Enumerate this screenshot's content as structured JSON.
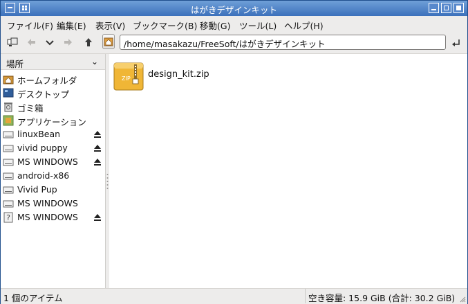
{
  "window": {
    "title": "はがきデザインキット"
  },
  "menu": {
    "file": "ファイル(F)",
    "edit": "編集(E)",
    "view": "表示(V)",
    "bookmarks": "ブックマーク(B)",
    "go": "移動(G)",
    "tools": "ツール(L)",
    "help": "ヘルプ(H)"
  },
  "toolbar": {
    "location": "/home/masakazu/FreeSoft/はがきデザインキット"
  },
  "sidebar": {
    "header": "場所",
    "items": [
      {
        "label": "ホームフォルダ",
        "icon": "home-folder-icon"
      },
      {
        "label": "デスクトップ",
        "icon": "desktop-icon"
      },
      {
        "label": "ゴミ箱",
        "icon": "trash-icon"
      },
      {
        "label": "アプリケーション",
        "icon": "applications-icon"
      },
      {
        "label": "linuxBean",
        "icon": "drive-icon",
        "eject": true
      },
      {
        "label": "vivid puppy",
        "icon": "drive-icon",
        "eject": true
      },
      {
        "label": "MS WINDOWS",
        "icon": "drive-icon",
        "eject": true
      },
      {
        "label": "android-x86",
        "icon": "drive-icon",
        "eject": false
      },
      {
        "label": "Vivid Pup",
        "icon": "drive-icon",
        "eject": false
      },
      {
        "label": "MS WINDOWS",
        "icon": "drive-icon",
        "eject": false
      },
      {
        "label": "MS WINDOWS",
        "icon": "unknown-drive-icon",
        "eject": true
      }
    ]
  },
  "files": [
    {
      "name": "design_kit.zip",
      "icon": "zip-archive-icon",
      "badge": "ZIP"
    }
  ],
  "status": {
    "count": "1 個のアイテム",
    "free_space": "空き容量: 15.9 GiB (合計: 30.2 GiB)"
  },
  "colors": {
    "titlebar": "#4a7dc4",
    "accent": "#f0b636"
  }
}
